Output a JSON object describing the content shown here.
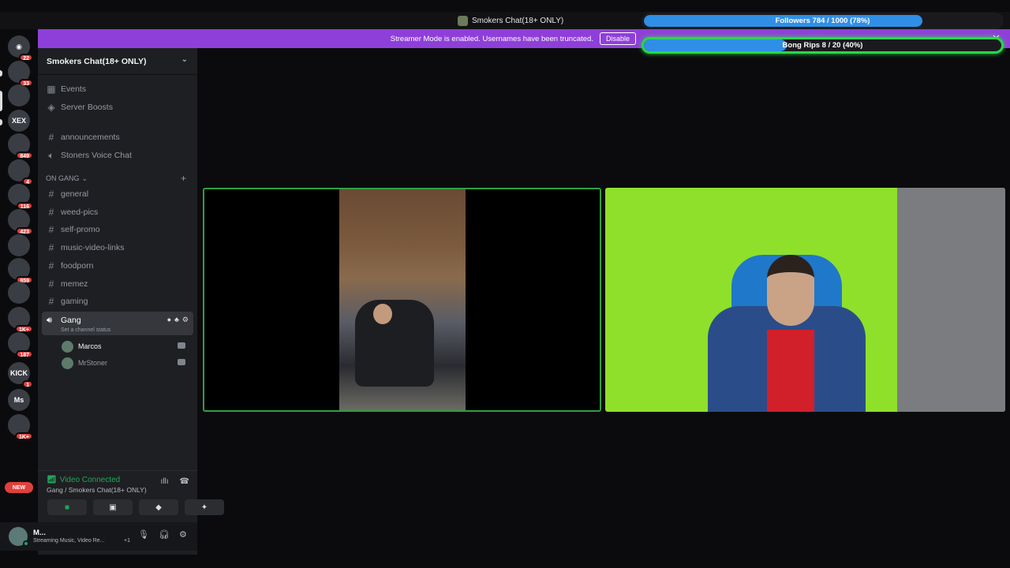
{
  "window": {
    "title": "Smokers Chat(18+ ONLY)"
  },
  "streamer_banner": {
    "text": "Streamer Mode is enabled. Usernames have been truncated.",
    "disable_label": "Disable",
    "close": "✕"
  },
  "overlays": {
    "followers": {
      "label": "Followers 784 / 1000 (78%)",
      "current": 784,
      "goal": 1000,
      "percent": 78
    },
    "bong_rips": {
      "label": "Bong Rips 8 / 20 (40%)",
      "current": 8,
      "goal": 20,
      "percent": 40
    }
  },
  "server_rail": {
    "items": [
      {
        "name": "direct-messages",
        "glyph": "◉",
        "badge": "22"
      },
      {
        "name": "server-1",
        "glyph": "",
        "badge": "33"
      },
      {
        "name": "server-smokers-chat",
        "glyph": "",
        "badge": ""
      },
      {
        "name": "server-xex",
        "glyph": "XEX",
        "badge": ""
      },
      {
        "name": "server-4",
        "glyph": "",
        "badge": "849"
      },
      {
        "name": "server-5",
        "glyph": "",
        "badge": "4"
      },
      {
        "name": "server-6",
        "glyph": "",
        "badge": "116"
      },
      {
        "name": "server-7",
        "glyph": "",
        "badge": "423"
      },
      {
        "name": "server-8",
        "glyph": "",
        "badge": ""
      },
      {
        "name": "server-9",
        "glyph": "",
        "badge": "859"
      },
      {
        "name": "server-10",
        "glyph": "",
        "badge": ""
      },
      {
        "name": "server-11",
        "glyph": "",
        "badge": "1K+"
      },
      {
        "name": "server-12",
        "glyph": "",
        "badge": "187"
      },
      {
        "name": "server-kick",
        "glyph": "KICK",
        "badge": "1"
      },
      {
        "name": "server-ms",
        "glyph": "Ms",
        "badge": ""
      },
      {
        "name": "server-16",
        "glyph": "",
        "badge": "1K+"
      }
    ],
    "new_badge": "NEW"
  },
  "sidebar": {
    "server_name": "Smokers Chat(18+ ONLY)",
    "top_items": [
      {
        "icon": "calendar-icon",
        "label": "Events"
      },
      {
        "icon": "boost-icon",
        "label": "Server Boosts"
      },
      {
        "icon": "hash-icon",
        "label": "announcements"
      },
      {
        "icon": "speaker-icon",
        "label": "Stoners Voice Chat"
      }
    ],
    "category": "ON GANG",
    "channels": [
      "general",
      "weed-pics",
      "self-promo",
      "music-video-links",
      "foodporn",
      "memez",
      "gaming"
    ],
    "voice_channel": {
      "name": "Gang",
      "status": "Set a channel status",
      "users": [
        "Marcos",
        "MrStoner"
      ]
    }
  },
  "voice_panel": {
    "status": "Video Connected",
    "location": "Gang / Smokers Chat(18+ ONLY)"
  },
  "user_bar": {
    "name": "M...",
    "activity": "Streaming Music, Video Re...",
    "extra": "+1"
  }
}
